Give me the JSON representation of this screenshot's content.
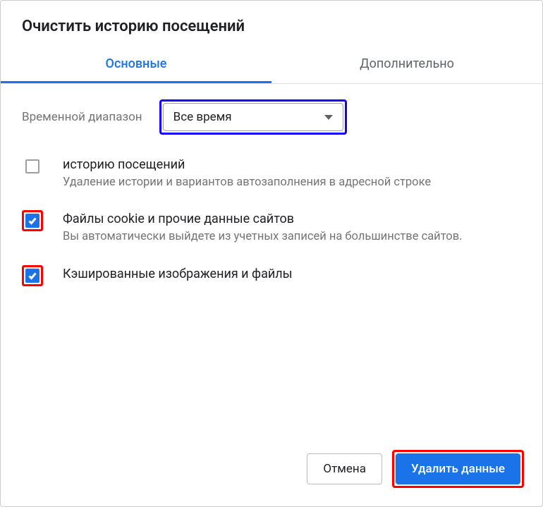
{
  "dialog": {
    "title": "Очистить историю посещений"
  },
  "tabs": {
    "basic": "Основные",
    "advanced": "Дополнительно"
  },
  "range": {
    "label": "Временной диапазон",
    "value": "Все время"
  },
  "options": [
    {
      "checked": false,
      "highlighted": false,
      "title": "историю посещений",
      "desc": "Удаление истории и вариантов автозаполнения в адресной строке"
    },
    {
      "checked": true,
      "highlighted": true,
      "title": "Файлы cookie и прочие данные сайтов",
      "desc": "Вы автоматически выйдете из учетных записей на большинстве сайтов."
    },
    {
      "checked": true,
      "highlighted": true,
      "title": "Кэшированные изображения и файлы",
      "desc": ""
    }
  ],
  "buttons": {
    "cancel": "Отмена",
    "clear": "Удалить данные"
  }
}
